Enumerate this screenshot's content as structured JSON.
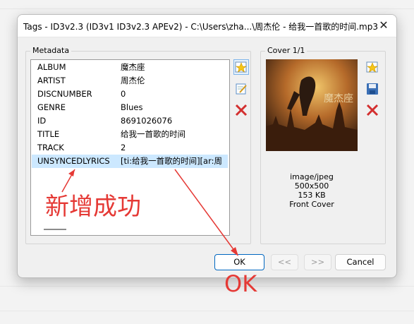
{
  "window": {
    "title": "Tags - ID3v2.3 (ID3v1 ID3v2.3 APEv2) - C:\\Users\\zha...\\周杰伦 - 给我一首歌的时间.mp3"
  },
  "metadata": {
    "legend": "Metadata",
    "rows": [
      {
        "key": "ALBUM",
        "value": "魔杰座"
      },
      {
        "key": "ARTIST",
        "value": "周杰伦"
      },
      {
        "key": "DISCNUMBER",
        "value": "0"
      },
      {
        "key": "GENRE",
        "value": "Blues"
      },
      {
        "key": "ID",
        "value": "8691026076"
      },
      {
        "key": "TITLE",
        "value": "给我一首歌的时间"
      },
      {
        "key": "TRACK",
        "value": "2"
      },
      {
        "key": "UNSYNCEDLYRICS",
        "value": "[ti:给我一首歌的时间][ar:周"
      }
    ]
  },
  "cover": {
    "legend": "Cover 1/1",
    "mime": "image/jpeg",
    "dims": "500x500",
    "size": "153 KB",
    "type": "Front Cover"
  },
  "buttons": {
    "ok": "OK",
    "prev": "<<",
    "next": ">>",
    "cancel": "Cancel"
  },
  "annotations": {
    "added": "新增成功",
    "ok": "OK"
  },
  "colors": {
    "annotation": "#e53935",
    "selection": "#cce8ff",
    "accent": "#0067c0"
  }
}
